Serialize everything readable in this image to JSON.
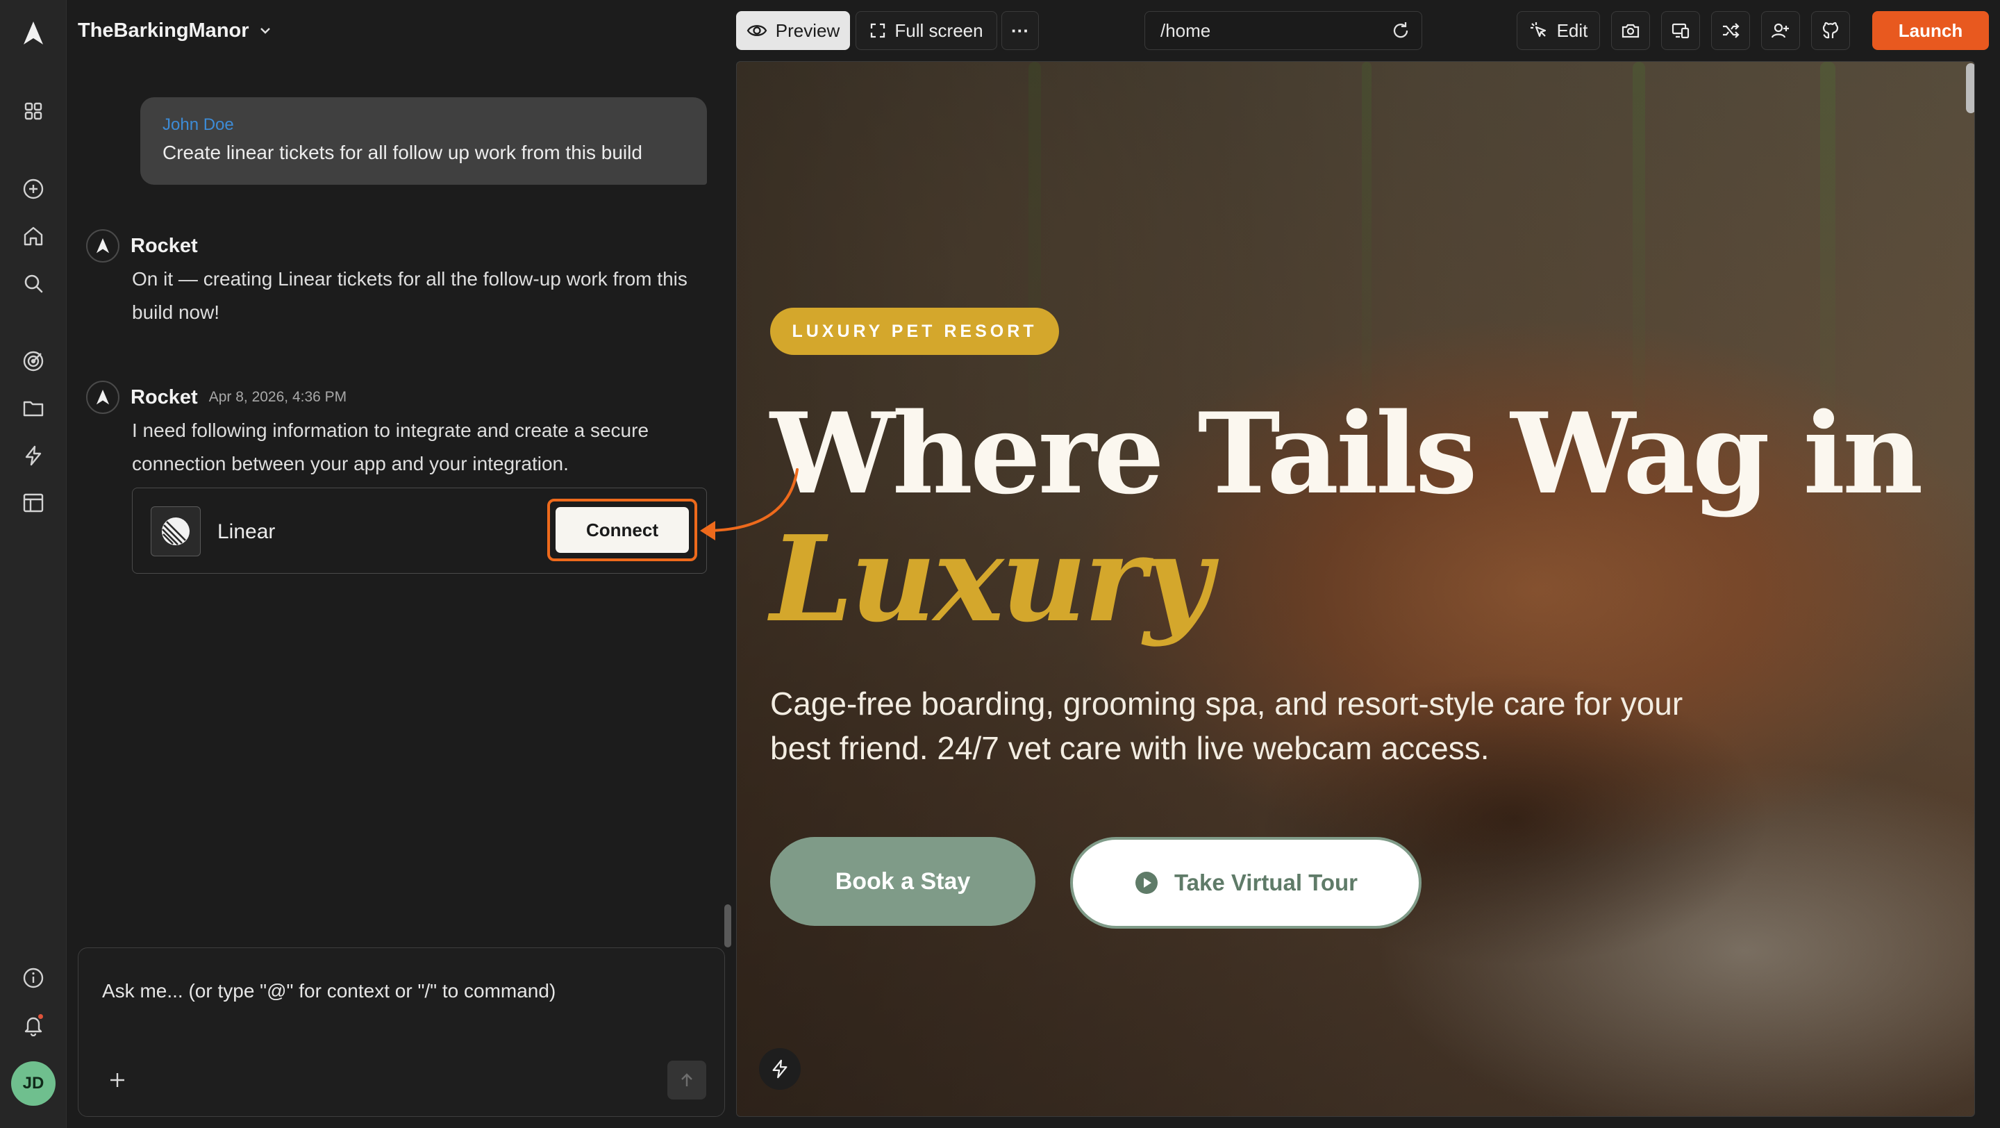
{
  "header": {
    "project_name": "TheBarkingManor",
    "preview_label": "Preview",
    "fullscreen_label": "Full screen",
    "more_label": "···",
    "url": "/home",
    "edit_label": "Edit",
    "launch_label": "Launch"
  },
  "sidebar": {
    "avatar_initials": "JD",
    "icons": [
      "grid-icon",
      "plus-circle-icon",
      "home-icon",
      "search-icon",
      "target-icon",
      "folder-icon",
      "lightning-icon",
      "layout-icon",
      "info-icon",
      "bell-icon"
    ]
  },
  "chat": {
    "user_message": {
      "author": "John Doe",
      "text": "Create linear tickets for all follow up work from this build"
    },
    "messages": [
      {
        "author": "Rocket",
        "time": "",
        "text": "On it — creating Linear tickets for all the follow-up work from this build now!"
      },
      {
        "author": "Rocket",
        "time": "Apr 8, 2026, 4:36 PM",
        "text": "I need following information to integrate and create a secure connection between your app and your integration."
      }
    ],
    "integration": {
      "name": "Linear",
      "connect_label": "Connect"
    },
    "composer_placeholder": "Ask me... (or type \"@\" for context or \"/\" to command)"
  },
  "preview": {
    "badge": "LUXURY PET RESORT",
    "headline_line1": "Where Tails Wag in",
    "headline_line2": "Luxury",
    "subheadline": "Cage-free boarding, grooming spa, and resort-style care for your best friend. 24/7 vet care with live webcam access.",
    "cta_primary": "Book a Stay",
    "cta_secondary": "Take Virtual Tour"
  },
  "colors": {
    "accent": "#e8591f",
    "gold": "#d4a72c",
    "sage": "#7f9b88",
    "link_blue": "#3d8bd6",
    "highlight": "#ee6a1c"
  }
}
